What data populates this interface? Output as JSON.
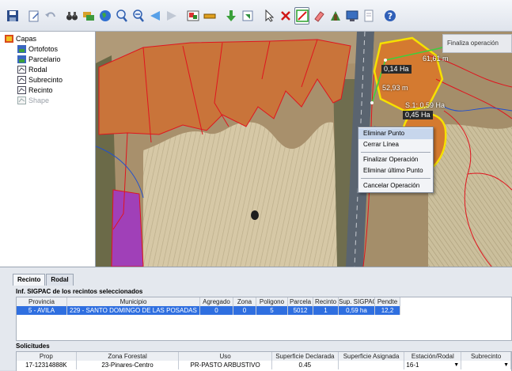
{
  "toolbar": {
    "buttons": [
      "save-icon",
      "edit-icon",
      "undo-icon",
      "binoculars-icon",
      "layers-icon",
      "globe-icon",
      "zoom-in-icon",
      "zoom-out-icon",
      "back-icon",
      "forward-icon",
      "select-icon",
      "minus-icon",
      "download-icon",
      "export-icon",
      "pointer-icon",
      "delete-icon",
      "draw-line-icon",
      "eraser-icon",
      "polygon-icon",
      "monitor-icon",
      "document-icon",
      "help-icon"
    ]
  },
  "layers": {
    "root": "Capas",
    "items": [
      "Ortofotos",
      "Parcelario",
      "Rodal",
      "Subrecinto",
      "Recinto",
      "Shape"
    ]
  },
  "map": {
    "hint": "Finaliza operación",
    "measures": [
      "61,61 m",
      "0,14 Ha",
      "52,93 m",
      "S.1: 0,59 Ha",
      "0,45 Ha"
    ]
  },
  "context_menu": {
    "items": [
      "Eliminar Punto",
      "Cerrar Línea",
      "Finalizar Operación",
      "Eliminar último Punto",
      "Cancelar Operación"
    ]
  },
  "bottom": {
    "tabs": [
      "Recinto",
      "Rodal"
    ],
    "sigpac_title": "Inf. SIGPAC de los recintos seleccionados",
    "sigpac_headers": [
      "Provincia",
      "Municipio",
      "Agregado",
      "Zona",
      "Poligono",
      "Parcela",
      "Recinto",
      "Sup. SIGPAC",
      "Pendte"
    ],
    "sigpac_row": [
      "5 - AVILA",
      "229 - SANTO DOMINGO DE LAS POSADAS",
      "0",
      "0",
      "5",
      "5012",
      "1",
      "0,59 ha",
      "12,2"
    ],
    "solicitudes_title": "Solicitudes",
    "sol_headers": [
      "Prop",
      "Zona Forestal",
      "Uso",
      "Superficie Declarada",
      "Superficie Asignada",
      "Estación/Rodal",
      "Subrecinto"
    ],
    "sol_row": [
      "17-12314888K",
      "23-Pinares-Centro",
      "PR-PASTO ARBUSTIVO",
      "0.45",
      "",
      "16-1",
      ""
    ]
  },
  "colors": {
    "selection": "#2f6fe0",
    "parcel_fill": "#c9743a",
    "boundary": "#e0141e",
    "highlight": "#f6e000"
  }
}
